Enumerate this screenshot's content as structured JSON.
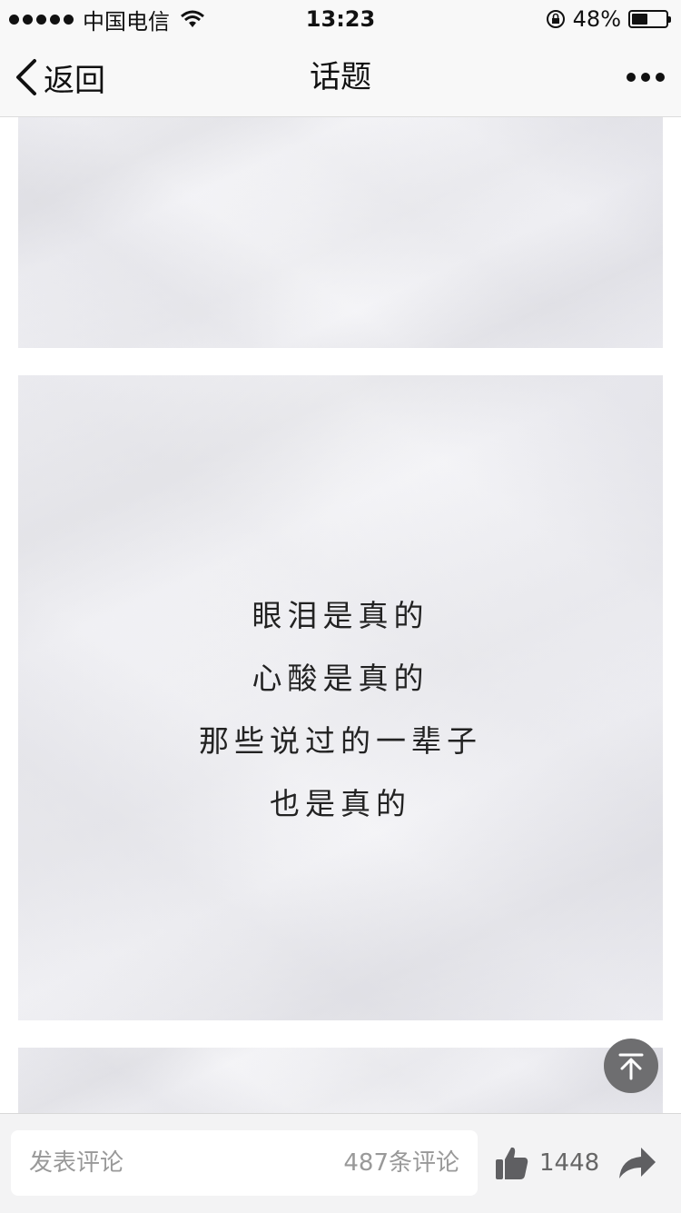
{
  "status_bar": {
    "carrier": "中国电信",
    "time": "13:23",
    "battery_percent_label": "48%",
    "battery_level": 0.48
  },
  "nav": {
    "back_label": "返回",
    "title": "话题"
  },
  "post": {
    "poem_lines": [
      "眼泪是真的",
      "心酸是真的",
      "那些说过的一辈子",
      "也是真的"
    ]
  },
  "bottom_bar": {
    "comment_placeholder": "发表评论",
    "comment_count": "487条评论",
    "like_count": "1448"
  },
  "icons": [
    "signal-dots-icon",
    "wifi-icon",
    "rotation-lock-icon",
    "battery-icon",
    "back-chevron-icon",
    "more-icon",
    "scroll-to-top-icon",
    "thumbs-up-icon",
    "share-arrow-icon"
  ]
}
